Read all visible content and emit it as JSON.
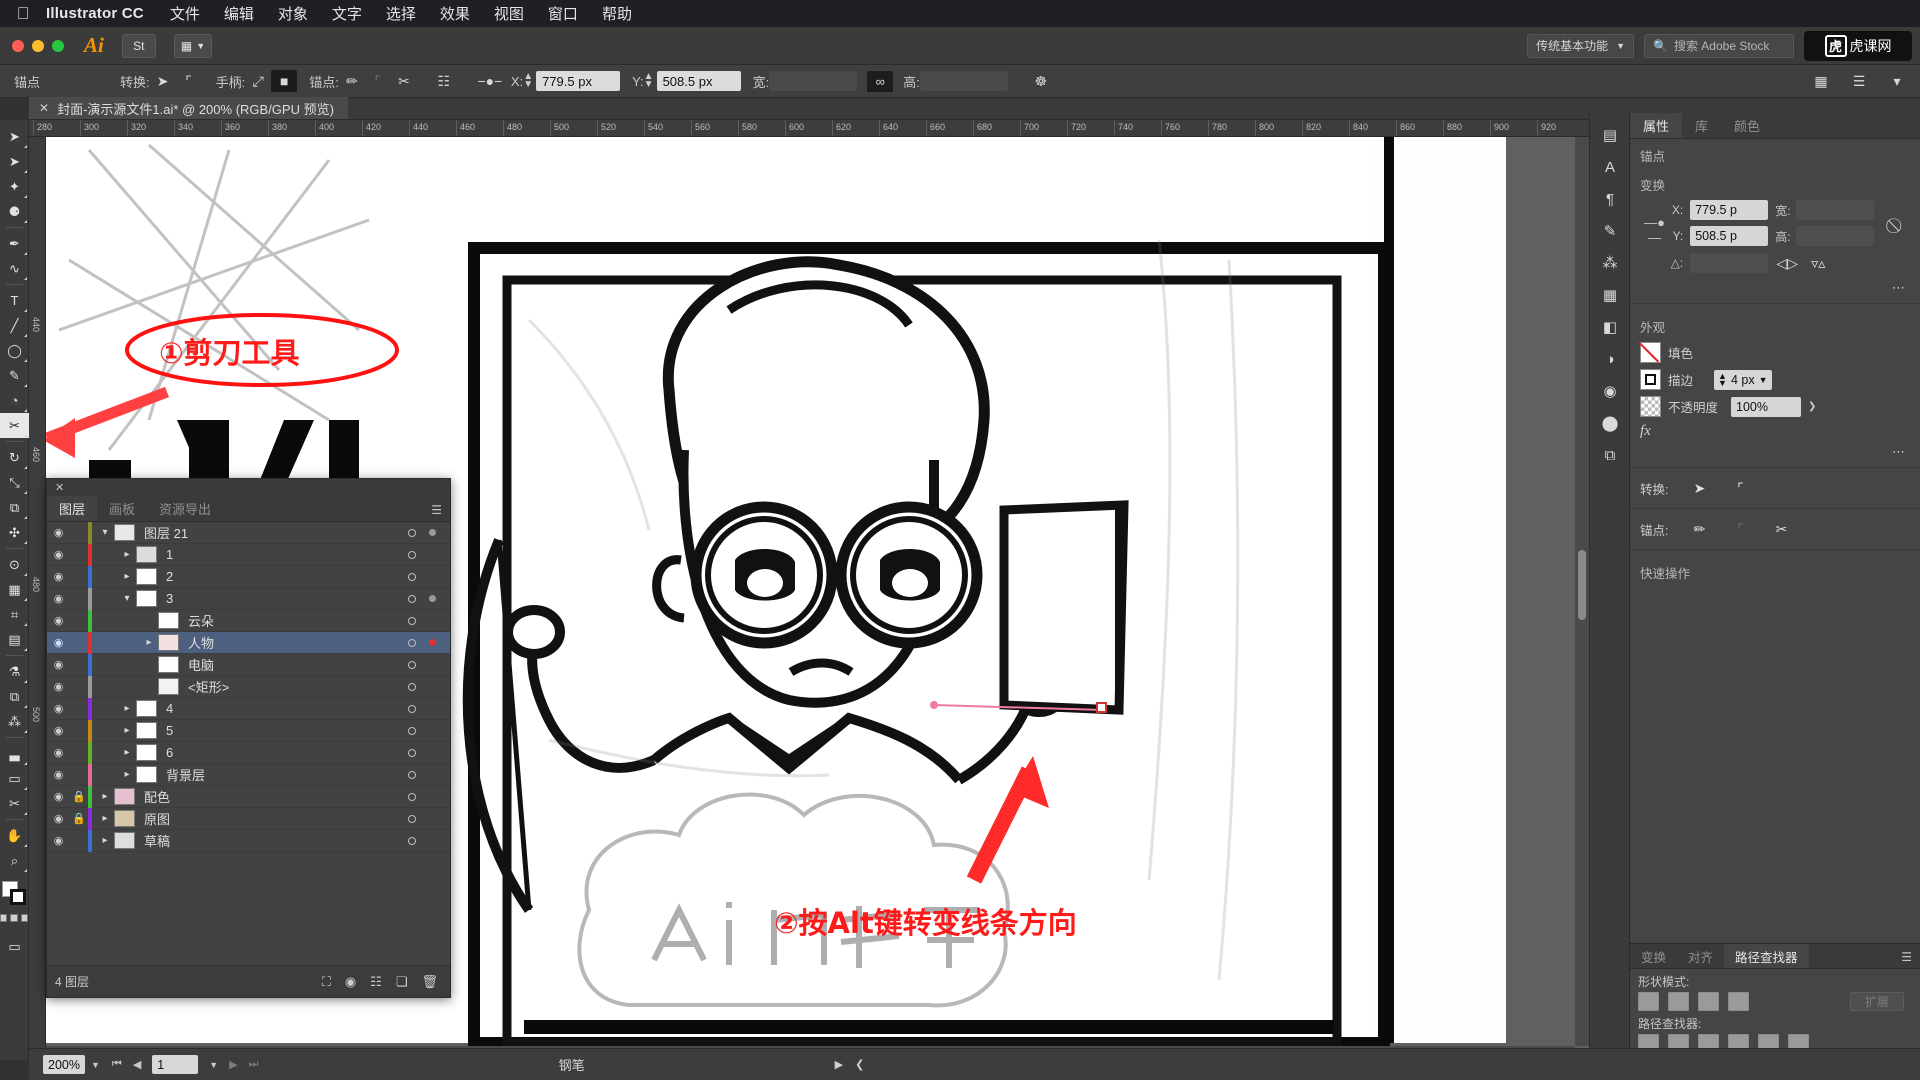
{
  "menubar": {
    "apple_icon": "apple-icon",
    "app_name": "Illustrator CC",
    "items": [
      "文件",
      "编辑",
      "对象",
      "文字",
      "选择",
      "效果",
      "视图",
      "窗口",
      "帮助"
    ]
  },
  "titlebar": {
    "ai_logo": "Ai",
    "stock_label": "St",
    "arrange_icon": "arrange-icon",
    "workspace": "传统基本功能",
    "search_placeholder": "搜索 Adobe Stock",
    "brand": "虎课网",
    "brand_mark": "虎"
  },
  "controlbar": {
    "context_label": "锚点",
    "convert_label": "转换:",
    "handle_label": "手柄:",
    "anchor_label": "锚点:",
    "x_label": "X:",
    "x_value": "779.5 px",
    "y_label": "Y:",
    "y_value": "508.5 px",
    "w_label": "宽:",
    "w_value": "",
    "h_label": "高:",
    "h_value": "",
    "link_icon": "link-icon",
    "align_icon": "align-icon"
  },
  "document_tab": {
    "close_icon": "close-icon",
    "title": "封面-演示源文件1.ai* @ 200% (RGB/GPU 预览)"
  },
  "toolbar": {
    "tools": [
      {
        "name": "selection-tool",
        "glyph": "➤"
      },
      {
        "name": "direct-selection-tool",
        "glyph": "➤"
      },
      {
        "name": "magic-wand-tool",
        "glyph": "✦"
      },
      {
        "name": "lasso-tool",
        "glyph": "⚈"
      },
      {
        "name": "pen-tool",
        "glyph": "✒"
      },
      {
        "name": "curvature-tool",
        "glyph": "∿"
      },
      {
        "name": "type-tool",
        "glyph": "T"
      },
      {
        "name": "line-segment-tool",
        "glyph": "╱"
      },
      {
        "name": "ellipse-tool",
        "glyph": "◯"
      },
      {
        "name": "paintbrush-tool",
        "glyph": "✎"
      },
      {
        "name": "shaper-tool",
        "glyph": "◔"
      },
      {
        "name": "scissors-tool",
        "glyph": "✂"
      },
      {
        "name": "rotate-tool",
        "glyph": "↻"
      },
      {
        "name": "scale-tool",
        "glyph": "⤡"
      },
      {
        "name": "width-tool",
        "glyph": "⧉"
      },
      {
        "name": "free-transform-tool",
        "glyph": "✣"
      },
      {
        "name": "shape-builder-tool",
        "glyph": "⊙"
      },
      {
        "name": "perspective-grid-tool",
        "glyph": "▦"
      },
      {
        "name": "mesh-tool",
        "glyph": "⌗"
      },
      {
        "name": "gradient-tool",
        "glyph": "▤"
      },
      {
        "name": "eyedropper-tool",
        "glyph": "⚗"
      },
      {
        "name": "blend-tool",
        "glyph": "⧉"
      },
      {
        "name": "symbol-sprayer-tool",
        "glyph": "⁂"
      },
      {
        "name": "column-graph-tool",
        "glyph": "▃"
      },
      {
        "name": "artboard-tool",
        "glyph": "▭"
      },
      {
        "name": "slice-tool",
        "glyph": "✂"
      },
      {
        "name": "hand-tool",
        "glyph": "✋"
      },
      {
        "name": "zoom-tool",
        "glyph": "⌕"
      }
    ],
    "fill_stroke_icon": "fill-stroke-swatches",
    "color-mode-icons": [
      "color-swatch-icon",
      "gradient-icon",
      "none-icon"
    ],
    "screen_mode_icon": "screen-mode-icon"
  },
  "rulers": {
    "h_ticks": [
      "280",
      "300",
      "320",
      "340",
      "360",
      "380",
      "400",
      "420",
      "440",
      "460",
      "480",
      "500",
      "520",
      "540",
      "560",
      "580",
      "600",
      "620",
      "640",
      "660",
      "680",
      "700",
      "720",
      "740",
      "760",
      "780",
      "800",
      "820",
      "840",
      "860",
      "880",
      "900",
      "920"
    ],
    "v_ticks": [
      "440",
      "460",
      "480",
      "500"
    ]
  },
  "layers_panel": {
    "close_icon": "close-icon",
    "menu_icon": "panel-menu-icon",
    "tabs": [
      {
        "label": "图层",
        "active": true
      },
      {
        "label": "画板",
        "active": false
      },
      {
        "label": "资源导出",
        "active": false
      }
    ],
    "rows": [
      {
        "name": "图层 21",
        "indent": 0,
        "twirl": "down",
        "color": "#8a8a2b",
        "locked": false,
        "selected": false,
        "thumb": "#e8e8e8",
        "target": false
      },
      {
        "name": "1",
        "indent": 1,
        "twirl": "right",
        "color": "#e03030",
        "locked": false,
        "selected": false,
        "thumb": "#dcdcdc",
        "target": false
      },
      {
        "name": "2",
        "indent": 1,
        "twirl": "right",
        "color": "#3a6fd8",
        "locked": false,
        "selected": false,
        "thumb": "#ffffff",
        "target": false
      },
      {
        "name": "3",
        "indent": 1,
        "twirl": "down",
        "color": "#9a9a9a",
        "locked": false,
        "selected": false,
        "thumb": "#ffffff",
        "target": false
      },
      {
        "name": "云朵",
        "indent": 2,
        "twirl": "none",
        "color": "#3cc23c",
        "locked": false,
        "selected": false,
        "thumb": "#ffffff",
        "target": false
      },
      {
        "name": "人物",
        "indent": 2,
        "twirl": "right",
        "color": "#e03030",
        "locked": false,
        "selected": true,
        "thumb": "#f3e0e0",
        "target": true
      },
      {
        "name": "电脑",
        "indent": 2,
        "twirl": "none",
        "color": "#3a6fd8",
        "locked": false,
        "selected": false,
        "thumb": "#ffffff",
        "target": false
      },
      {
        "name": "<矩形>",
        "indent": 2,
        "twirl": "none",
        "color": "#9a9a9a",
        "locked": false,
        "selected": false,
        "thumb": "#f2f2f2",
        "target": false
      },
      {
        "name": "4",
        "indent": 1,
        "twirl": "right",
        "color": "#8a2be2",
        "locked": false,
        "selected": false,
        "thumb": "#ffffff",
        "target": false
      },
      {
        "name": "5",
        "indent": 1,
        "twirl": "right",
        "color": "#c58a15",
        "locked": false,
        "selected": false,
        "thumb": "#ffffff",
        "target": false
      },
      {
        "name": "6",
        "indent": 1,
        "twirl": "right",
        "color": "#63b32a",
        "locked": false,
        "selected": false,
        "thumb": "#ffffff",
        "target": false
      },
      {
        "name": "背景层",
        "indent": 1,
        "twirl": "right",
        "color": "#e8689a",
        "locked": false,
        "selected": false,
        "thumb": "#ffffff",
        "target": false
      },
      {
        "name": "配色",
        "indent": 0,
        "twirl": "right",
        "color": "#3cc23c",
        "locked": true,
        "selected": false,
        "thumb": "#e6c0d0",
        "target": false
      },
      {
        "name": "原图",
        "indent": 0,
        "twirl": "right",
        "color": "#8a2be2",
        "locked": true,
        "selected": false,
        "thumb": "#d8c6a8",
        "target": false
      },
      {
        "name": "草稿",
        "indent": 0,
        "twirl": "right",
        "color": "#3a6fd8",
        "locked": false,
        "selected": false,
        "thumb": "#dedede",
        "target": false
      }
    ],
    "footer": {
      "count": "4 图层",
      "icons": [
        "locate-object-icon",
        "make-clipping-mask-icon",
        "new-sublayer-icon",
        "new-layer-icon",
        "delete-layer-icon"
      ]
    }
  },
  "icon_dock": {
    "icons": [
      "libraries-icon",
      "character-icon",
      "paragraph-icon",
      "brushes-icon",
      "symbols-icon",
      "swatches-icon",
      "gradient-icon",
      "transparency-icon",
      "appearance-icon",
      "graphic-styles-icon",
      "layers-icon"
    ]
  },
  "properties_panel": {
    "tabs": [
      {
        "label": "属性",
        "active": true
      },
      {
        "label": "库",
        "active": false
      },
      {
        "label": "颜色",
        "active": false
      }
    ],
    "selection_label": "锚点",
    "transform": {
      "section": "变换",
      "x_label": "X:",
      "x_value": "779.5 p",
      "y_label": "Y:",
      "y_value": "508.5 p",
      "w_label": "宽:",
      "w_value": "",
      "h_label": "高:",
      "h_value": "",
      "angle_label": "△:",
      "angle_value": "",
      "link_icon": "unlink-icon",
      "flip_h_icon": "flip-horizontal-icon",
      "flip_v_icon": "flip-vertical-icon",
      "more_icon": "more-options-icon"
    },
    "appearance": {
      "section": "外观",
      "fill_label": "填色",
      "stroke_label": "描边",
      "stroke_value": "4 px",
      "opacity_label": "不透明度",
      "opacity_value": "100%",
      "fx_label": "fx",
      "more_icon": "more-options-icon"
    },
    "convert": {
      "label": "转换:",
      "icons": [
        "convert-to-corner-icon",
        "convert-to-smooth-icon"
      ]
    },
    "anchor": {
      "label": "锚点:",
      "icons": [
        "anchor-point-icon",
        "handle-icon",
        "remove-anchor-icon"
      ]
    },
    "quick_actions": {
      "label": "快速操作"
    }
  },
  "pathfinder_panel": {
    "tabs": [
      {
        "label": "变换",
        "active": false
      },
      {
        "label": "对齐",
        "active": false
      },
      {
        "label": "路径查找器",
        "active": true
      }
    ],
    "menu_icon": "panel-menu-icon",
    "shape_modes_label": "形状模式:",
    "shape_modes": [
      "unite-icon",
      "minus-front-icon",
      "intersect-icon",
      "exclude-icon"
    ],
    "expand_label": "扩展",
    "pathfinders_label": "路径查找器:",
    "pathfinders": [
      "divide-icon",
      "trim-icon",
      "merge-icon",
      "crop-icon",
      "outline-icon",
      "minus-back-icon"
    ]
  },
  "statusbar": {
    "zoom": "200%",
    "first_icon": "first-page-icon",
    "prev_icon": "prev-page-icon",
    "page": "1",
    "next_icon": "next-page-icon",
    "last_icon": "last-page-icon",
    "tool_name": "钢笔",
    "play_icon": "play-icon",
    "arrow_icon": "left-arrow-icon"
  },
  "annotations": [
    {
      "id": "a1",
      "text": "①剪刀工具",
      "color": "#ff1111"
    },
    {
      "id": "a2",
      "text": "②按Alt键转变线条方向",
      "color": "#ff1111"
    }
  ],
  "colors": {
    "accent_selection": "#4e6080",
    "annotation_red": "#ff1111",
    "panel_bg": "#454545",
    "canvas_bg": "#606060"
  }
}
